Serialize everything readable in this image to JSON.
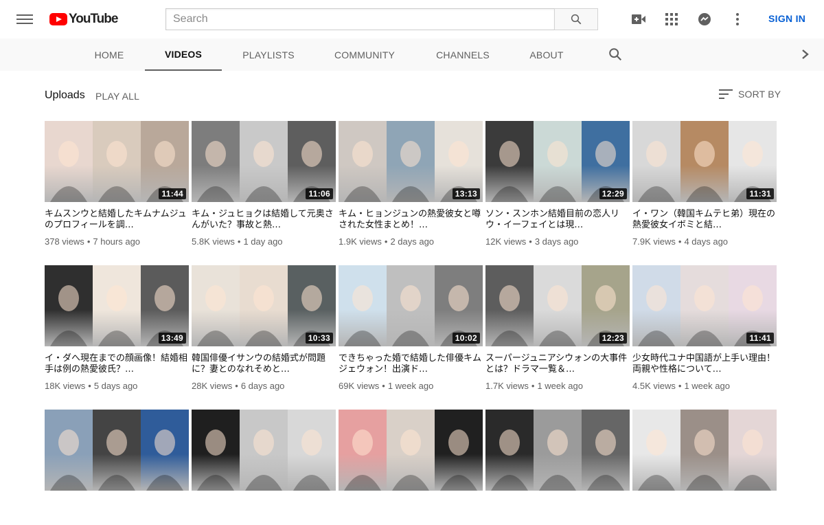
{
  "masthead": {
    "logo_text": "YouTube",
    "search_placeholder": "Search",
    "search_value": "",
    "icons": [
      "create-video-icon",
      "apps-icon",
      "messages-icon",
      "more-icon"
    ],
    "sign_in_label": "SIGN IN"
  },
  "tabs": [
    {
      "label": "HOME",
      "active": false
    },
    {
      "label": "VIDEOS",
      "active": true
    },
    {
      "label": "PLAYLISTS",
      "active": false
    },
    {
      "label": "COMMUNITY",
      "active": false
    },
    {
      "label": "CHANNELS",
      "active": false
    },
    {
      "label": "ABOUT",
      "active": false
    }
  ],
  "section": {
    "title": "Uploads",
    "play_all_label": "PLAY ALL",
    "sort_label": "SORT BY"
  },
  "colors": {
    "brand": "#ff0000",
    "link": "#065fd4",
    "meta": "#606060"
  },
  "videos": [
    {
      "title": "キムスンウと結婚したキムナムジュのプロフィールを調…",
      "views": "378 views",
      "age": "7 hours ago",
      "duration": "11:44"
    },
    {
      "title": "キム・ジュヒョクは結婚して元奥さんがいた？事故と熱…",
      "views": "5.8K views",
      "age": "1 day ago",
      "duration": "11:06"
    },
    {
      "title": "キム・ヒョンジュンの熱愛彼女と噂された女性まとめ！…",
      "views": "1.9K views",
      "age": "2 days ago",
      "duration": "13:13"
    },
    {
      "title": "ソン・スンホン結婚目前の恋人リウ・イーフェイとは現…",
      "views": "12K views",
      "age": "3 days ago",
      "duration": "12:29"
    },
    {
      "title": "イ・ワン（韓国キムテヒ弟）現在の熱愛彼女イボミと結…",
      "views": "7.9K views",
      "age": "4 days ago",
      "duration": "11:31"
    },
    {
      "title": "イ・ダへ現在までの顔画像！結婚相手は例の熱愛彼氏？…",
      "views": "18K views",
      "age": "5 days ago",
      "duration": "13:49"
    },
    {
      "title": "韓国俳優イサンウの結婚式が問題に？妻とのなれそめと…",
      "views": "28K views",
      "age": "6 days ago",
      "duration": "10:33"
    },
    {
      "title": "できちゃった婚で結婚した俳優キムジェウォン！出演ド…",
      "views": "69K views",
      "age": "1 week ago",
      "duration": "10:02"
    },
    {
      "title": "スーパージュニアシウォンの大事件とは？ドラマ一覧＆…",
      "views": "1.7K views",
      "age": "1 week ago",
      "duration": "12:23"
    },
    {
      "title": "少女時代ユナ中国語が上手い理由！両親や性格について…",
      "views": "4.5K views",
      "age": "1 week ago",
      "duration": "11:41"
    },
    {
      "title": "",
      "views": "",
      "age": "",
      "duration": ""
    },
    {
      "title": "",
      "views": "",
      "age": "",
      "duration": ""
    },
    {
      "title": "",
      "views": "",
      "age": "",
      "duration": ""
    },
    {
      "title": "",
      "views": "",
      "age": "",
      "duration": ""
    },
    {
      "title": "",
      "views": "",
      "age": "",
      "duration": ""
    }
  ]
}
